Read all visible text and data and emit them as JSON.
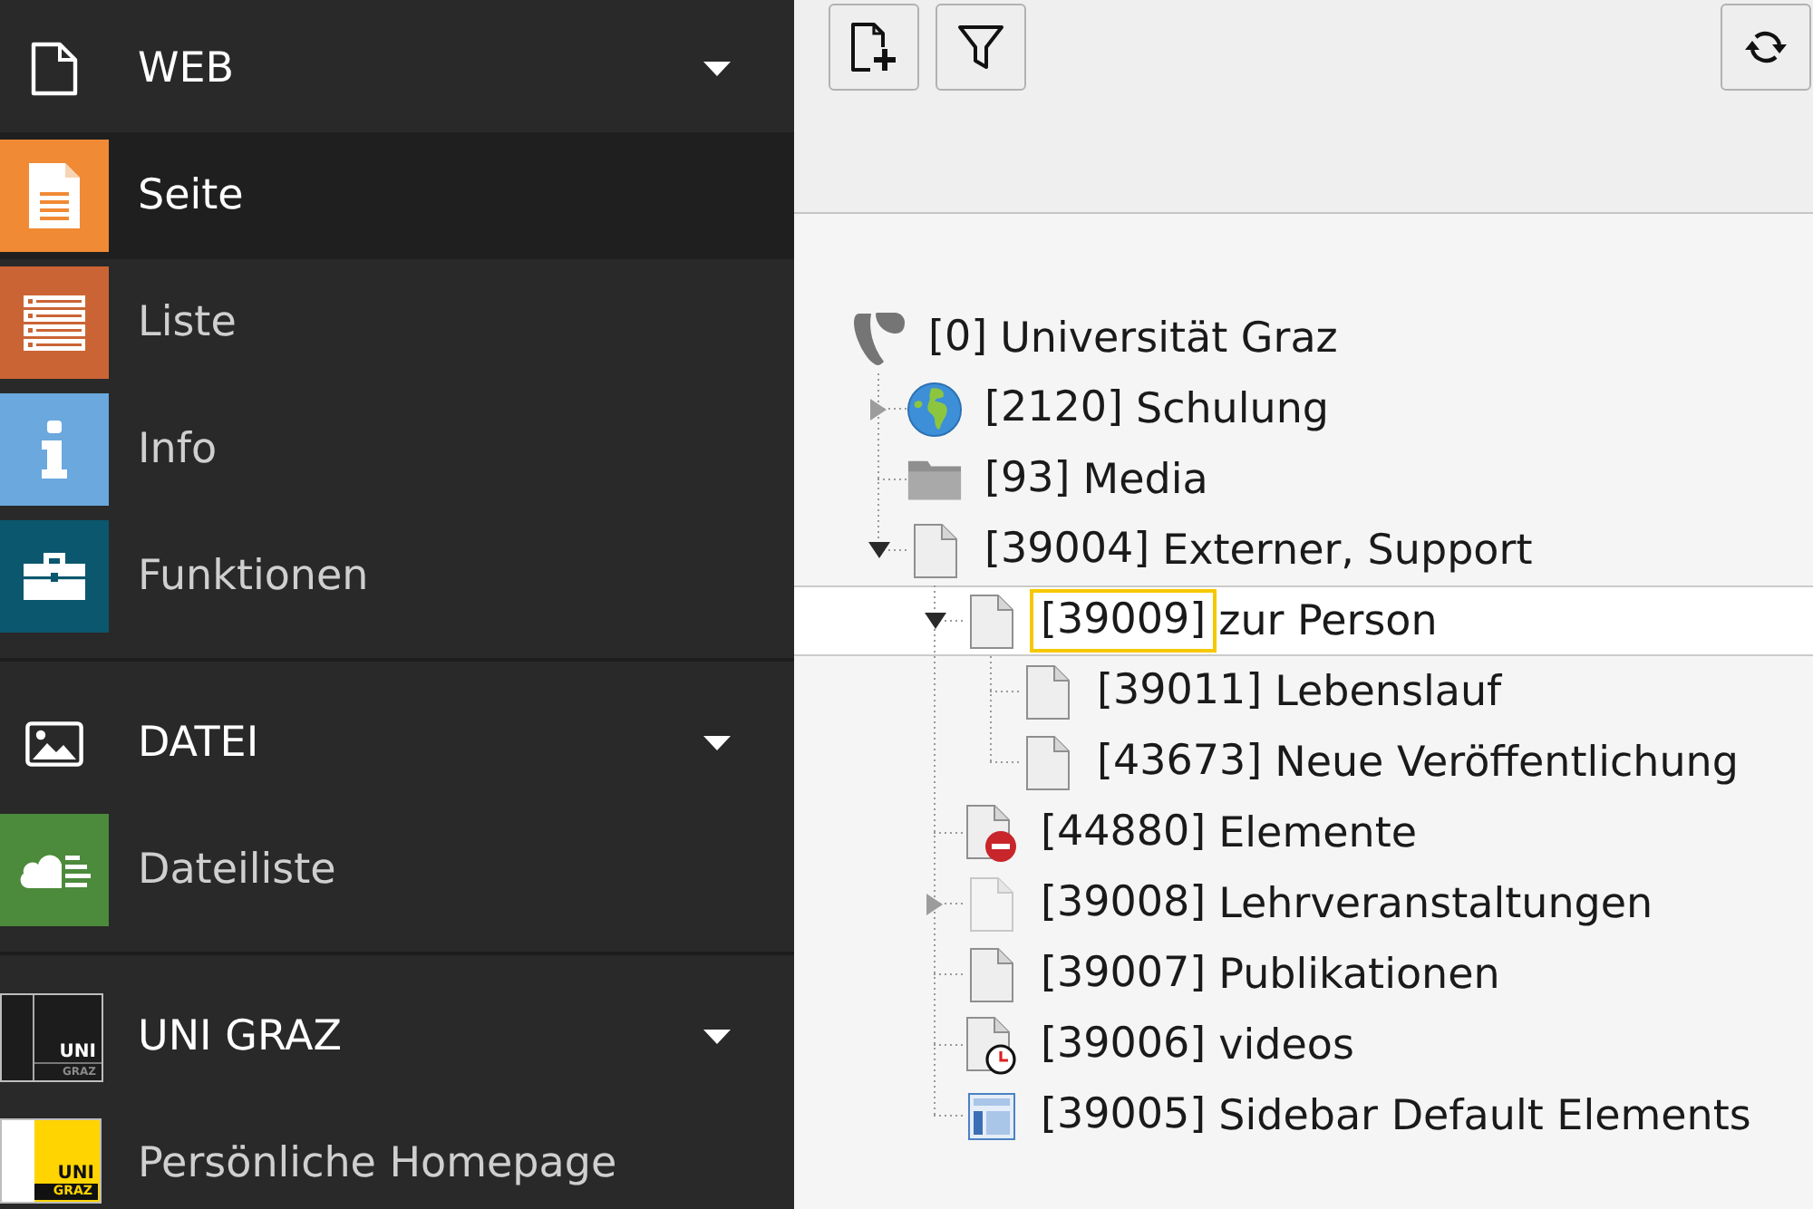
{
  "sidebar": {
    "sections": [
      {
        "title": "WEB",
        "kind": "page",
        "expanded": true,
        "items": [
          {
            "label": "Seite",
            "kind": "page",
            "color": "#f08a35",
            "selected": true
          },
          {
            "label": "Liste",
            "kind": "list",
            "color": "#cb6434",
            "selected": false
          },
          {
            "label": "Info",
            "kind": "info",
            "color": "#6aa8de",
            "selected": false
          },
          {
            "label": "Funktionen",
            "kind": "tools",
            "color": "#0b576e",
            "selected": false
          }
        ]
      },
      {
        "title": "DATEI",
        "kind": "image",
        "expanded": true,
        "items": [
          {
            "label": "Dateiliste",
            "kind": "files",
            "color": "#4c8a3c",
            "selected": false
          }
        ]
      },
      {
        "title": "UNI GRAZ",
        "kind": "logo",
        "logo_text": [
          "UNI",
          "GRAZ"
        ],
        "expanded": true,
        "items": [
          {
            "label": "Persönliche Homepage",
            "kind": "logo",
            "logo_text": [
              "UNI",
              "GRAZ"
            ],
            "selected": false
          }
        ]
      }
    ]
  },
  "page_tree": {
    "nodes": [
      {
        "id": "[0]",
        "title": "Universität Graz",
        "kind": "root",
        "selected": false,
        "marked": false,
        "children": [
          {
            "id": "[2120]",
            "title": "Schulung",
            "kind": "site",
            "expanded": false,
            "selected": false,
            "marked": false
          },
          {
            "id": "[93]",
            "title": "Media",
            "kind": "folder",
            "selected": false,
            "marked": false
          },
          {
            "id": "[39004]",
            "title": "Externer, Support",
            "kind": "page",
            "expanded": true,
            "selected": false,
            "marked": false,
            "children": [
              {
                "id": "[39009]",
                "title": "zur Person",
                "kind": "page",
                "expanded": true,
                "selected": true,
                "marked": true,
                "children": [
                  {
                    "id": "[39011]",
                    "title": "Lebenslauf",
                    "kind": "page",
                    "selected": false,
                    "marked": false
                  },
                  {
                    "id": "[43673]",
                    "title": "Neue Veröffentlichung",
                    "kind": "page",
                    "selected": false,
                    "marked": false
                  }
                ]
              },
              {
                "id": "[44880]",
                "title": "Elemente",
                "kind": "hidden",
                "selected": false,
                "marked": false
              },
              {
                "id": "[39008]",
                "title": "Lehrveranstaltungen",
                "kind": "unlisted",
                "expanded": false,
                "selected": false,
                "marked": false
              },
              {
                "id": "[39007]",
                "title": "Publikationen",
                "kind": "page",
                "selected": false,
                "marked": false
              },
              {
                "id": "[39006]",
                "title": "videos",
                "kind": "scheduled",
                "selected": false,
                "marked": false
              },
              {
                "id": "[39005]",
                "title": "Sidebar Default Elements",
                "kind": "layout",
                "selected": false,
                "marked": false
              }
            ]
          }
        ]
      }
    ]
  }
}
